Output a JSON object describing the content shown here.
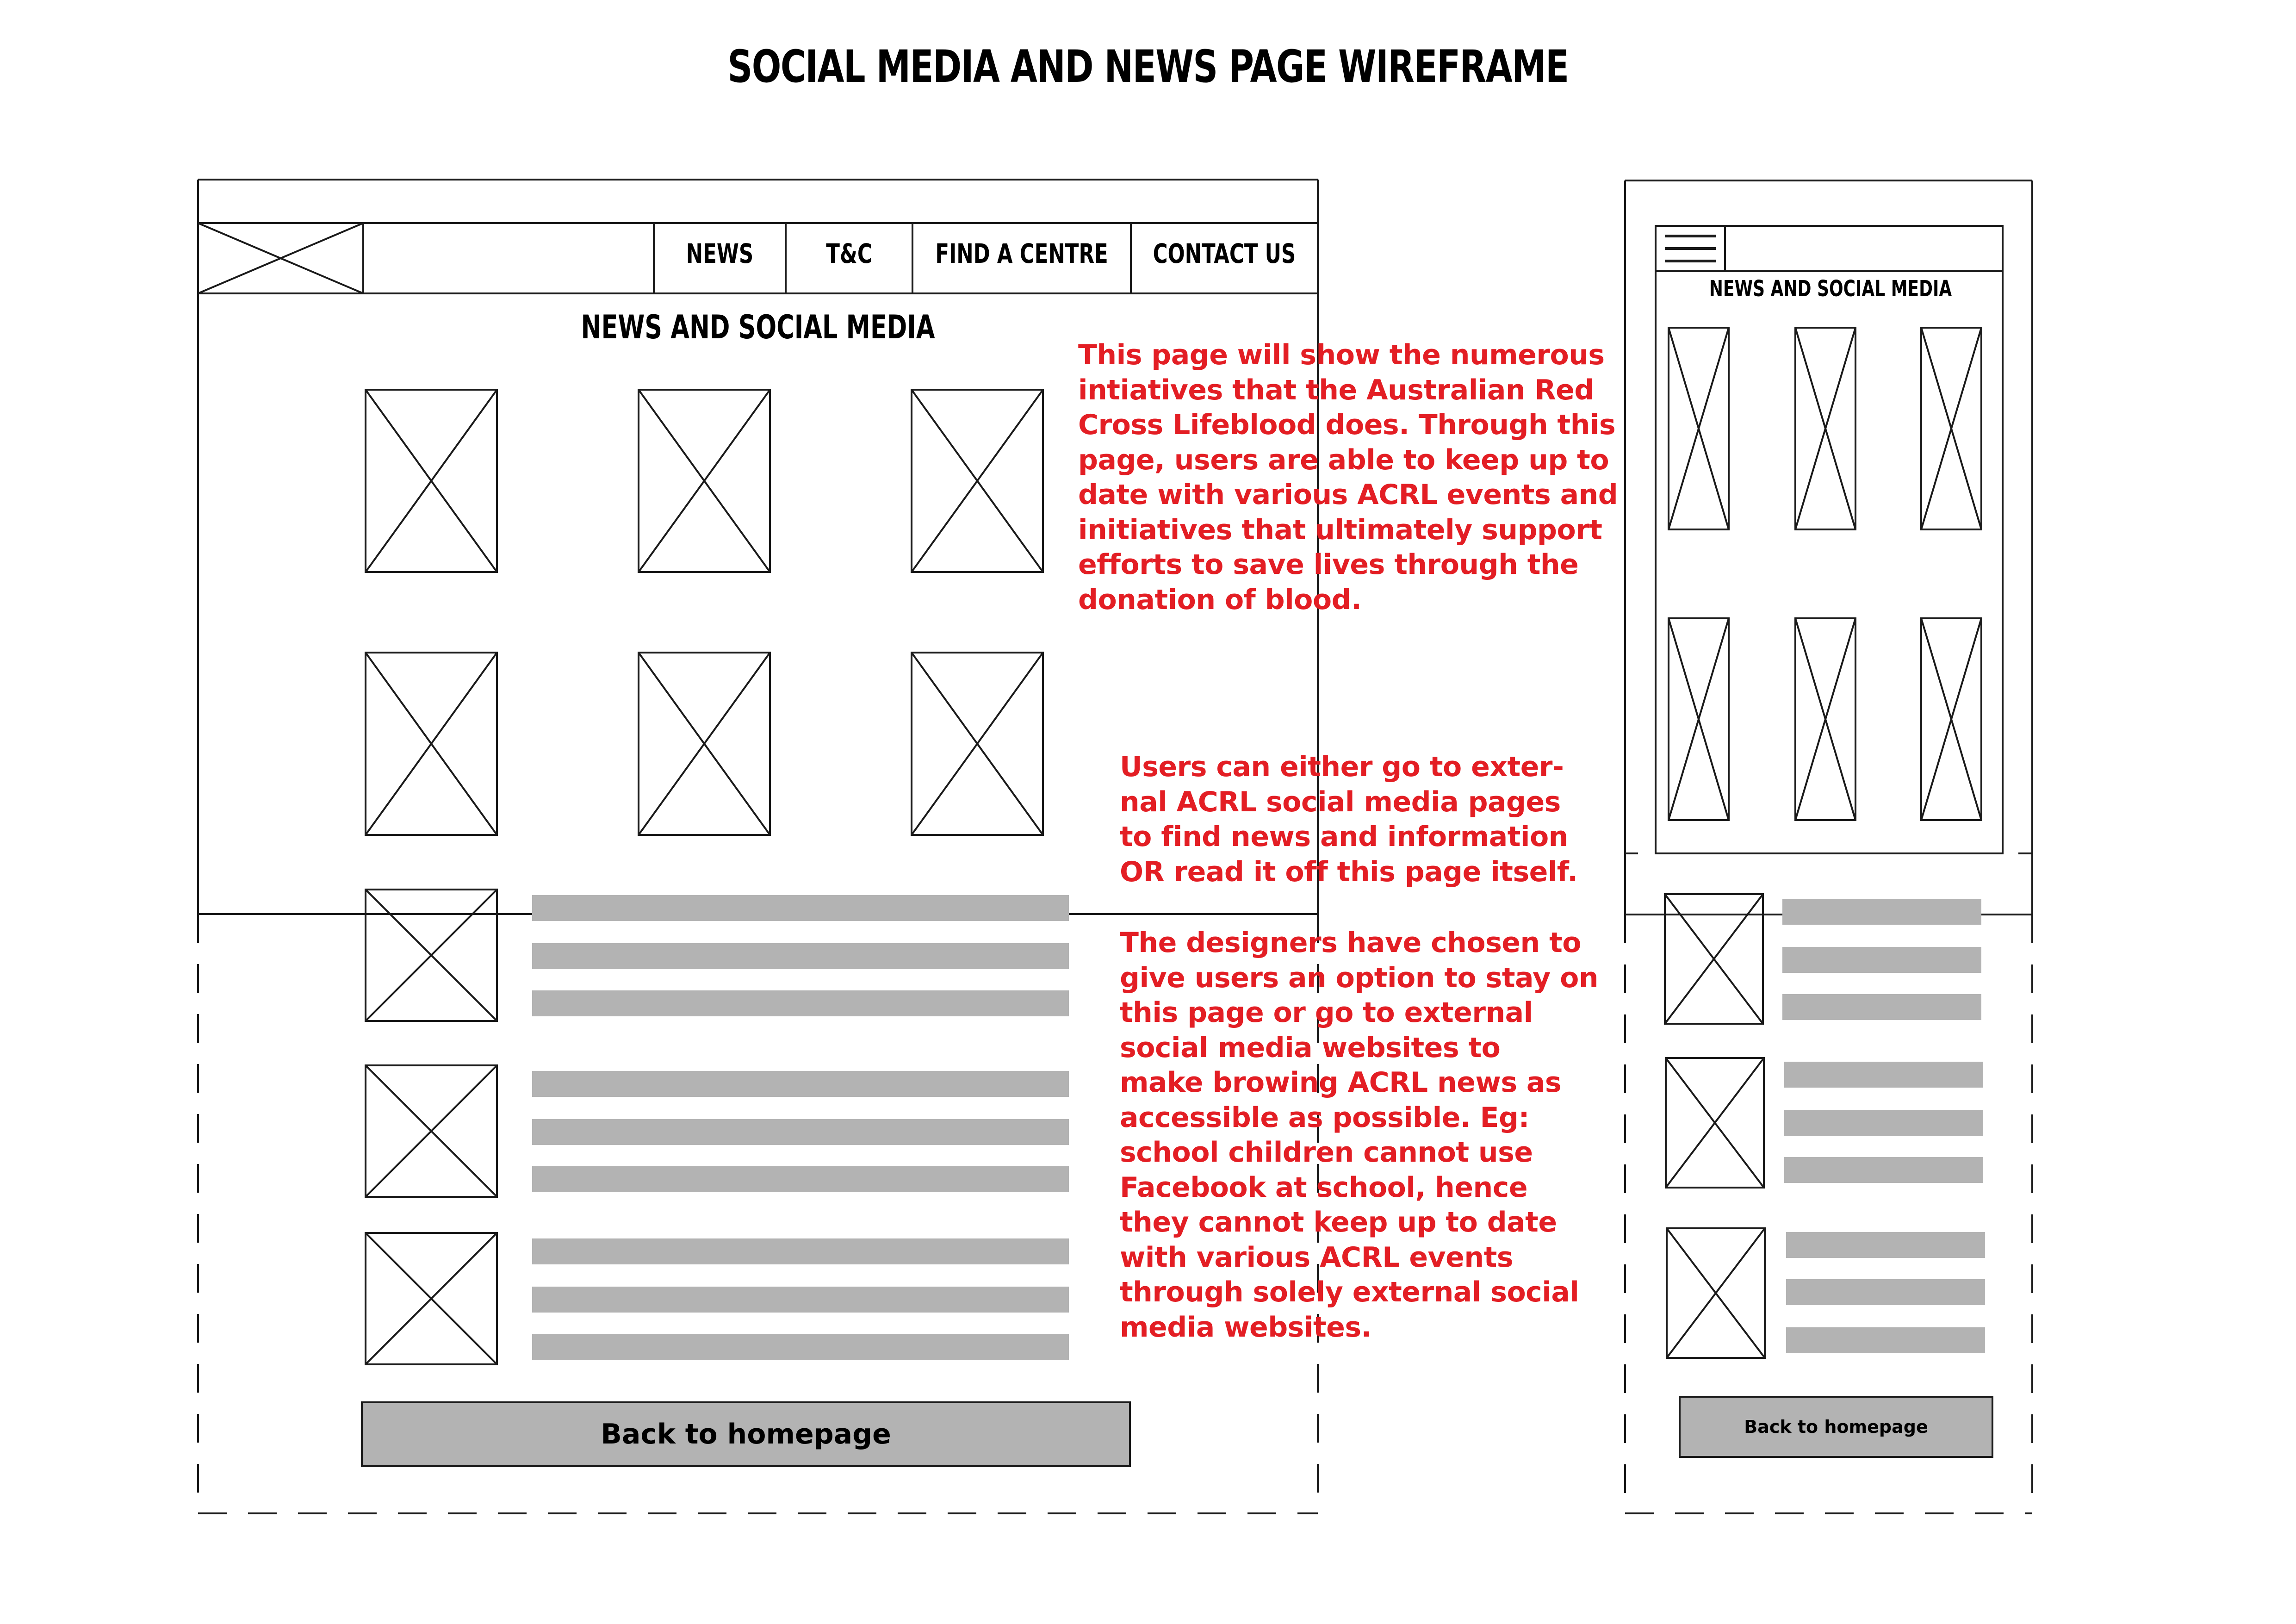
{
  "title": "SOCIAL MEDIA AND NEWS PAGE WIREFRAME",
  "desktop": {
    "nav": {
      "news": "NEWS",
      "tc": "T&C",
      "find_centre": "FIND A CENTRE",
      "contact": "CONTACT US"
    },
    "heading": "NEWS AND SOCIAL MEDIA",
    "back_button": "Back to homepage"
  },
  "mobile": {
    "heading": "NEWS AND SOCIAL MEDIA",
    "back_button": "Back to homepage"
  },
  "notes": {
    "note1": "This page will show the numerous\nintiatives that the Australian Red\nCross Lifeblood does. Through this\npage, users are able to keep up to\ndate with various ACRL events and\ninitiatives that ultimately support\nefforts to save lives through the\ndonation of blood.",
    "note2": "Users can either go to exter-\nnal ACRL social media pages\nto find news and information\nOR read it off this page itself.",
    "note3": "The designers have chosen to\ngive users an option to stay on\nthis page or go to external\nsocial media websites to\nmake browing ACRL news as\naccessible as possible. Eg:\nschool children cannot use\nFacebook at school, hence\nthey cannot keep up to date\nwith various ACRL events\nthrough solely external social\nmedia websites."
  },
  "colors": {
    "line": "#1a1a1a",
    "placeholder_bar": "#b3b3b3",
    "note_red": "#e31e24"
  },
  "icons": {
    "image_placeholder": "crossed-box",
    "menu": "hamburger-icon"
  }
}
